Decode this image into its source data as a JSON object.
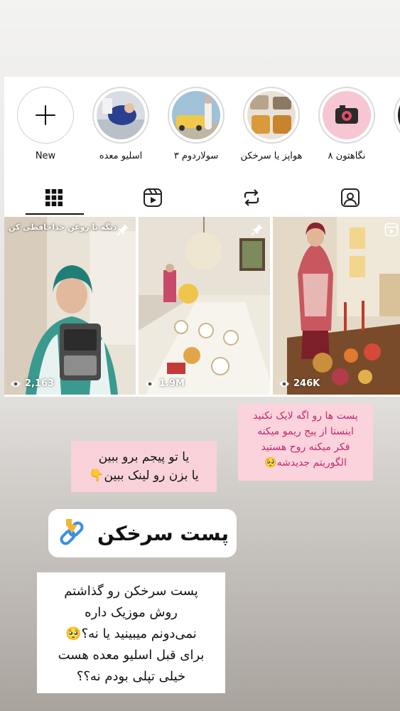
{
  "highlights": [
    {
      "label": "New",
      "icon": "plus-icon"
    },
    {
      "label": "اسلیو معده"
    },
    {
      "label": "سولاردوم ۳"
    },
    {
      "label": "هواپز یا سرخکن"
    },
    {
      "label": "نگاهتون ۸"
    }
  ],
  "tabs": [
    {
      "icon": "grid-icon",
      "active": true
    },
    {
      "icon": "reels-icon"
    },
    {
      "icon": "reposts-icon"
    },
    {
      "icon": "tagged-icon"
    }
  ],
  "posts": [
    {
      "overlay": "دیگه با روغن خداحافظی کن",
      "views": "2,163",
      "badge": "pin-icon"
    },
    {
      "views": "1.9M",
      "badge": "pin-icon"
    },
    {
      "views": "246K",
      "badge": "reels-icon"
    }
  ],
  "notes": {
    "pink": [
      "پست ها رو اگه لایک نکنید",
      "اینستا از پیج ریمو میکنه",
      "فکر میکنه روح هستید",
      "الگوریتم جدیدشه🥺"
    ],
    "follow": [
      "یا تو پیجم برو ببین",
      "یا بزن رو لینک ببین👇"
    ],
    "link_label": "پست سرخکن",
    "white": [
      "پست سرخکن رو گذاشتم",
      "روش موزیک داره",
      "نمی‌دونم میبینید یا نه؟🥺",
      "برای قبل اسلیو معده هست",
      "خیلی تپلی بودم نه؟؟"
    ]
  },
  "colors": {
    "pink_text": "#c6276a",
    "link_blue": "#3a8fe0"
  }
}
